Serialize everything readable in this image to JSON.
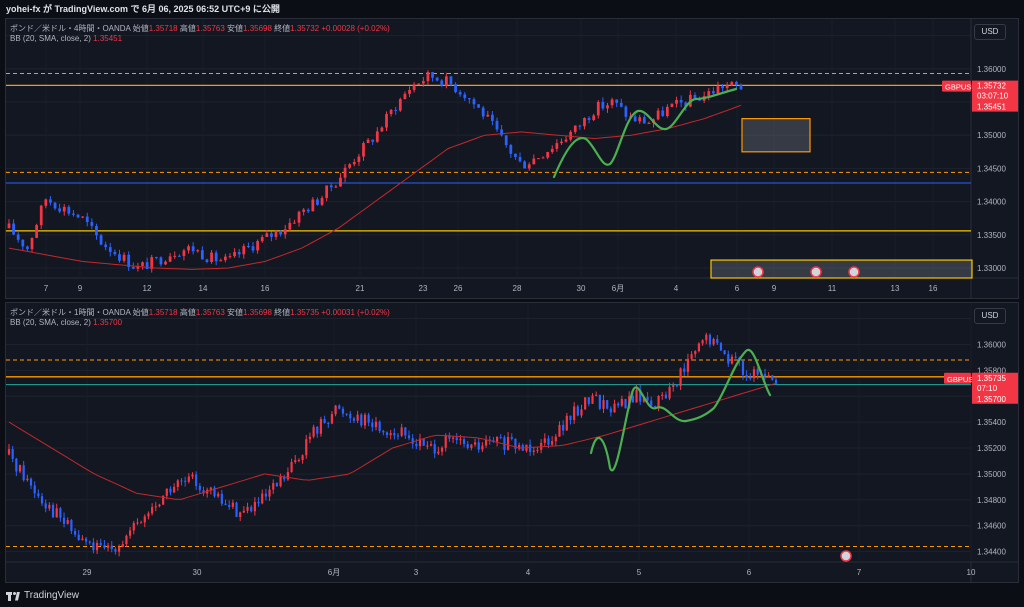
{
  "header": {
    "text": "yohei-fx が TradingView.com で 6月 06, 2025 06:52 UTC+9 に公開"
  },
  "colors": {
    "up": "#f23645",
    "down": "#2962ff",
    "bb": "#c2292b",
    "hline_orange": "#ff9800",
    "hline_yellow": "#f7c600",
    "hline_blue": "#2962ff",
    "price_label": "#f23645",
    "wave": "#4caf50"
  },
  "top": {
    "legend_line1_prefix": "ポンド／米ドル・4時間・OANDA",
    "legend_o_label": "始値",
    "legend_o": "1.35718",
    "legend_h_label": "高値",
    "legend_h": "1.35763",
    "legend_l_label": "安値",
    "legend_l": "1.35698",
    "legend_c_label": "終値",
    "legend_c": "1.35732",
    "legend_chg": "+0.00028 (+0.02%)",
    "legend_line2": "BB (20, SMA, close, 2)",
    "legend_bb": "1.35451",
    "currency_button": "USD",
    "price_ticks": [
      "1.36500",
      "1.36000",
      "1.35500",
      "1.35000",
      "1.34500",
      "1.34000",
      "1.33500",
      "1.33000"
    ],
    "time_ticks": [
      "7",
      "9",
      "12",
      "14",
      "16",
      "21",
      "23",
      "26",
      "28",
      "30",
      "6月",
      "4",
      "6",
      "9",
      "11",
      "13",
      "16"
    ],
    "symbol_label": "GBPUSD",
    "last_price": "1.35732",
    "countdown": "03:07:10",
    "bb_value": "1.35451"
  },
  "bottom": {
    "legend_line1_prefix": "ポンド／米ドル・1時間・OANDA",
    "legend_o_label": "始値",
    "legend_o": "1.35718",
    "legend_h_label": "高値",
    "legend_h": "1.35763",
    "legend_l_label": "安値",
    "legend_l": "1.35698",
    "legend_c_label": "終値",
    "legend_c": "1.35735",
    "legend_chg": "+0.00031 (+0.02%)",
    "legend_line2": "BB (20, SMA, close, 2)",
    "legend_bb": "1.35700",
    "currency_button": "USD",
    "price_ticks": [
      "1.36200",
      "1.36000",
      "1.35800",
      "1.35600",
      "1.35400",
      "1.35200",
      "1.35000",
      "1.34800",
      "1.34600",
      "1.34400"
    ],
    "time_ticks": [
      "29",
      "30",
      "6月",
      "3",
      "4",
      "5",
      "6",
      "7",
      "10"
    ],
    "symbol_label": "GBPUSD",
    "last_price": "1.35735",
    "countdown": "07:10",
    "bb_value": "1.35700"
  },
  "footer": {
    "brand": "TradingView",
    "logo_icon": "tradingview-logo-icon"
  },
  "chart_data": [
    {
      "type": "candlestick",
      "title": "",
      "symbol": "GBPUSD",
      "timeframe": "4H",
      "ylim": [
        1.3285,
        1.3675
      ],
      "x_tick_labels": [
        "7",
        "9",
        "12",
        "14",
        "16",
        "21",
        "23",
        "26",
        "28",
        "30",
        "6月",
        "4",
        "6",
        "9",
        "11",
        "13",
        "16"
      ],
      "close_path_approx": [
        1.336,
        1.333,
        1.3405,
        1.339,
        1.3375,
        1.334,
        1.332,
        1.33,
        1.331,
        1.3325,
        1.333,
        1.3315,
        1.331,
        1.333,
        1.3345,
        1.336,
        1.3385,
        1.3405,
        1.3435,
        1.347,
        1.35,
        1.354,
        1.3575,
        1.359,
        1.358,
        1.356,
        1.353,
        1.349,
        1.3455,
        1.347,
        1.349,
        1.351,
        1.354,
        1.355,
        1.3525,
        1.352,
        1.354,
        1.355,
        1.356,
        1.3575,
        1.3573
      ],
      "bb_basis_approx": [
        1.333,
        1.332,
        1.331,
        1.3305,
        1.33,
        1.3298,
        1.33,
        1.331,
        1.333,
        1.336,
        1.34,
        1.344,
        1.348,
        1.35,
        1.3505,
        1.35,
        1.3495,
        1.35,
        1.351,
        1.3525,
        1.3545
      ],
      "horizontal_levels": [
        1.3593,
        1.3575,
        1.3444,
        1.3428,
        1.3356
      ],
      "zones": [
        {
          "from": 1.3475,
          "to": 1.3525,
          "label": ""
        },
        {
          "from": 1.3283,
          "to": 1.3312,
          "label": ""
        }
      ]
    },
    {
      "type": "candlestick",
      "title": "",
      "symbol": "GBPUSD",
      "timeframe": "1H",
      "ylim": [
        1.3432,
        1.3632
      ],
      "x_tick_labels": [
        "29",
        "30",
        "6月",
        "3",
        "4",
        "5",
        "6",
        "7",
        "10"
      ],
      "close_path_approx": [
        1.3515,
        1.349,
        1.347,
        1.345,
        1.344,
        1.345,
        1.347,
        1.349,
        1.3495,
        1.348,
        1.347,
        1.348,
        1.35,
        1.353,
        1.355,
        1.3545,
        1.3535,
        1.353,
        1.352,
        1.3525,
        1.352,
        1.3525,
        1.352,
        1.3525,
        1.354,
        1.356,
        1.355,
        1.356,
        1.3555,
        1.358,
        1.3605,
        1.359,
        1.3575,
        1.3573
      ],
      "bb_basis_approx": [
        1.354,
        1.352,
        1.35,
        1.3485,
        1.348,
        1.349,
        1.35,
        1.3495,
        1.35,
        1.352,
        1.353,
        1.3528,
        1.352,
        1.3522,
        1.353,
        1.354,
        1.355,
        1.356,
        1.357
      ],
      "horizontal_levels": [
        1.3588,
        1.3575,
        1.3569,
        1.3444
      ],
      "zones": []
    }
  ]
}
